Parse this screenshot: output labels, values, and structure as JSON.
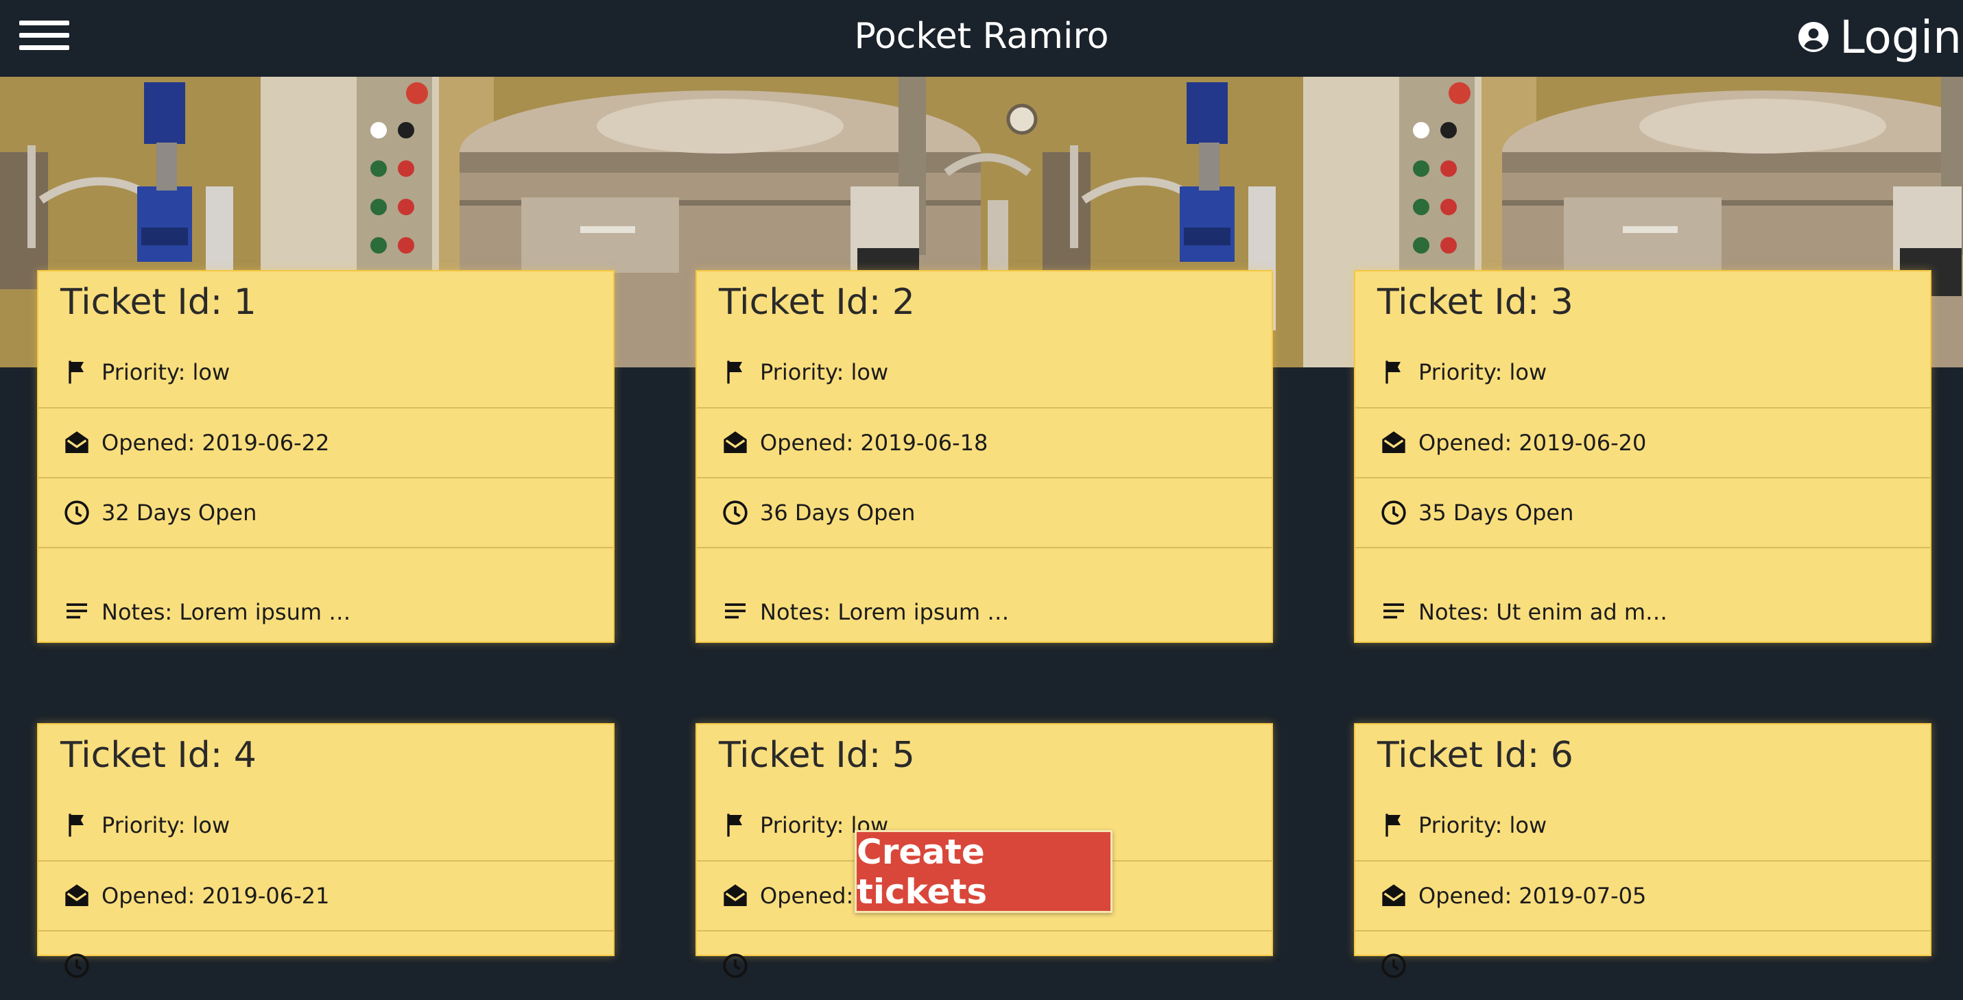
{
  "header": {
    "title": "Pocket Ramiro",
    "login_label": "Login",
    "menu_icon": "hamburger-menu-icon",
    "login_icon": "user-circle-icon"
  },
  "hero": {
    "icon": "industrial-machinery-photo"
  },
  "labels": {
    "ticket_id_prefix": "Ticket Id: ",
    "priority_prefix": "Priority: ",
    "opened_prefix": "Opened: ",
    "days_open_suffix": " Days Open",
    "notes_prefix": "Notes: "
  },
  "icons": {
    "priority": "flag-icon",
    "opened": "envelope-open-icon",
    "days": "clock-icon",
    "notes": "notes-lines-icon"
  },
  "tickets": [
    {
      "title": "Ticket Id: 1",
      "priority": "Priority: low",
      "opened": "Opened: 2019-06-22",
      "days_open": "32 Days Open",
      "notes": "Notes: Lorem ipsum …"
    },
    {
      "title": "Ticket Id: 2",
      "priority": "Priority: low",
      "opened": "Opened: 2019-06-18",
      "days_open": "36 Days Open",
      "notes": "Notes: Lorem ipsum …"
    },
    {
      "title": "Ticket Id: 3",
      "priority": "Priority: low",
      "opened": "Opened: 2019-06-20",
      "days_open": "35 Days Open",
      "notes": "Notes: Ut enim ad m…"
    },
    {
      "title": "Ticket Id: 4",
      "priority": "Priority: low",
      "opened": "Opened: 2019-06-21"
    },
    {
      "title": "Ticket Id: 5",
      "priority": "Priority: low",
      "opened": "Opened: 2"
    },
    {
      "title": "Ticket Id: 6",
      "priority": "Priority: low",
      "opened": "Opened: 2019-07-05"
    }
  ],
  "create_button": {
    "label": "Create tickets"
  },
  "colors": {
    "background": "#1a222b",
    "card": "#f9de7d",
    "card_border": "#f4c642",
    "create_button": "#d9473a"
  }
}
